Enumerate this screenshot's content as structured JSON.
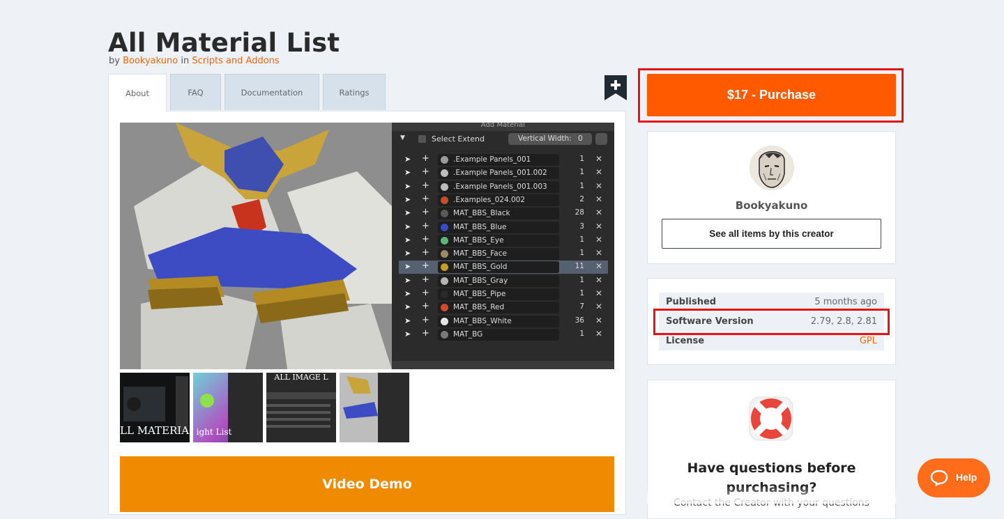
{
  "product": {
    "title": "All Material List",
    "by_prefix": "by",
    "author": "Bookyakuno",
    "in_word": "in",
    "category": "Scripts and Addons"
  },
  "tabs": [
    {
      "label": "About",
      "active": true
    },
    {
      "label": "FAQ",
      "active": false
    },
    {
      "label": "Documentation",
      "active": false
    },
    {
      "label": "Ratings",
      "active": false
    }
  ],
  "addon_panel": {
    "header": "Add Material",
    "header_right": "(x)",
    "select_extend": "Select Extend",
    "vertical_width_label": "Vertical Width:",
    "vertical_width_value": "0",
    "materials": [
      {
        "name": ".Example Panels_001",
        "count": "1",
        "color": "#9a9a9a"
      },
      {
        "name": ".Example Panels_001.002",
        "count": "1",
        "color": "#bdbdbd"
      },
      {
        "name": ".Example Panels_001.003",
        "count": "1",
        "color": "#bdbdbd"
      },
      {
        "name": ".Examples_024.002",
        "count": "2",
        "color": "#c0502c"
      },
      {
        "name": "MAT_BBS_Black",
        "count": "28",
        "color": "#5a5a5a"
      },
      {
        "name": "MAT_BBS_Blue",
        "count": "3",
        "color": "#3a4bc0"
      },
      {
        "name": "MAT_BBS_Eye",
        "count": "1",
        "color": "#5fb37c"
      },
      {
        "name": "MAT_BBS_Face",
        "count": "1",
        "color": "#9a8a6a"
      },
      {
        "name": "MAT_BBS_Gold",
        "count": "11",
        "color": "#c79a2a",
        "selected": true
      },
      {
        "name": "MAT_BBS_Gray",
        "count": "1",
        "color": "#b4b4b4"
      },
      {
        "name": "MAT_BBS_Pipe",
        "count": "1",
        "color": "#2a2a2a"
      },
      {
        "name": "MAT_BBS_Red",
        "count": "7",
        "color": "#d04a2a"
      },
      {
        "name": "MAT_BBS_White",
        "count": "36",
        "color": "#e6e6e6"
      },
      {
        "name": "MAT_BG",
        "count": "1",
        "color": "#7a7a7a"
      }
    ]
  },
  "thumbnails": [
    {
      "caption": "LL MATERIAL"
    },
    {
      "caption": "ight List"
    },
    {
      "caption": "ALL IMAGE L"
    },
    {
      "caption": ""
    }
  ],
  "video_button": "Video Demo",
  "purchase_button": "$17 - Purchase",
  "creator": {
    "name": "Bookyakuno",
    "see_all": "See all items by this creator"
  },
  "meta": [
    {
      "key": "Published",
      "value": "5 months ago"
    },
    {
      "key": "Software Version",
      "value": "2.79, 2.8, 2.81"
    },
    {
      "key": "License",
      "value": "GPL"
    }
  ],
  "support": {
    "question": "Have questions before purchasing?",
    "contact": "Contact the Creator with your questions"
  },
  "help_button": "Help",
  "colors": {
    "accent": "#ff5a00",
    "link": "#f0660a",
    "video": "#f08a00",
    "highlight": "#e81212"
  }
}
